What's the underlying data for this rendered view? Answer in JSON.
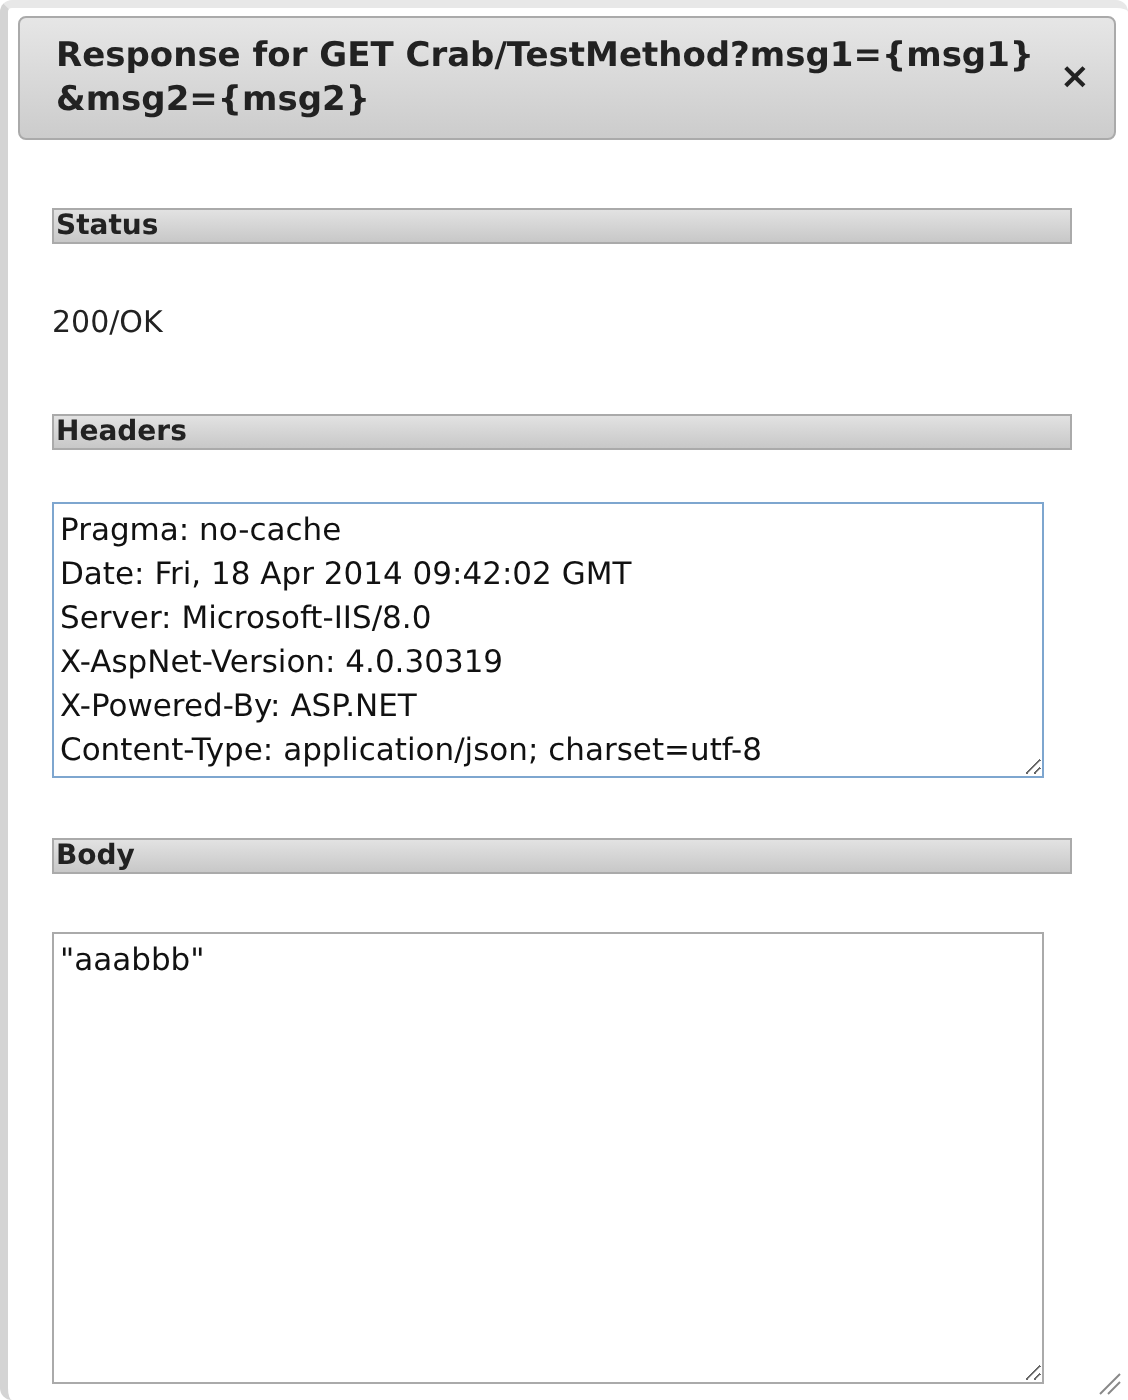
{
  "dialog": {
    "title": "Response for GET Crab/TestMethod?msg1={msg1}&msg2={msg2}",
    "close": "×"
  },
  "sections": [
    {
      "kind": "text",
      "heading": "Status",
      "value": "200/OK"
    },
    {
      "kind": "scrolling",
      "heading": "Headers",
      "lines": [
        "Pragma: no-cache",
        "Date: Fri, 18 Apr 2014 09:42:02 GMT",
        "Server: Microsoft-IIS/8.0",
        "X-AspNet-Version: 4.0.30319",
        "X-Powered-By: ASP.NET",
        "Content-Type: application/json; charset=utf-8"
      ]
    },
    {
      "kind": "box",
      "heading": "Body",
      "lines": [
        "\"aaabbb\""
      ]
    }
  ]
}
